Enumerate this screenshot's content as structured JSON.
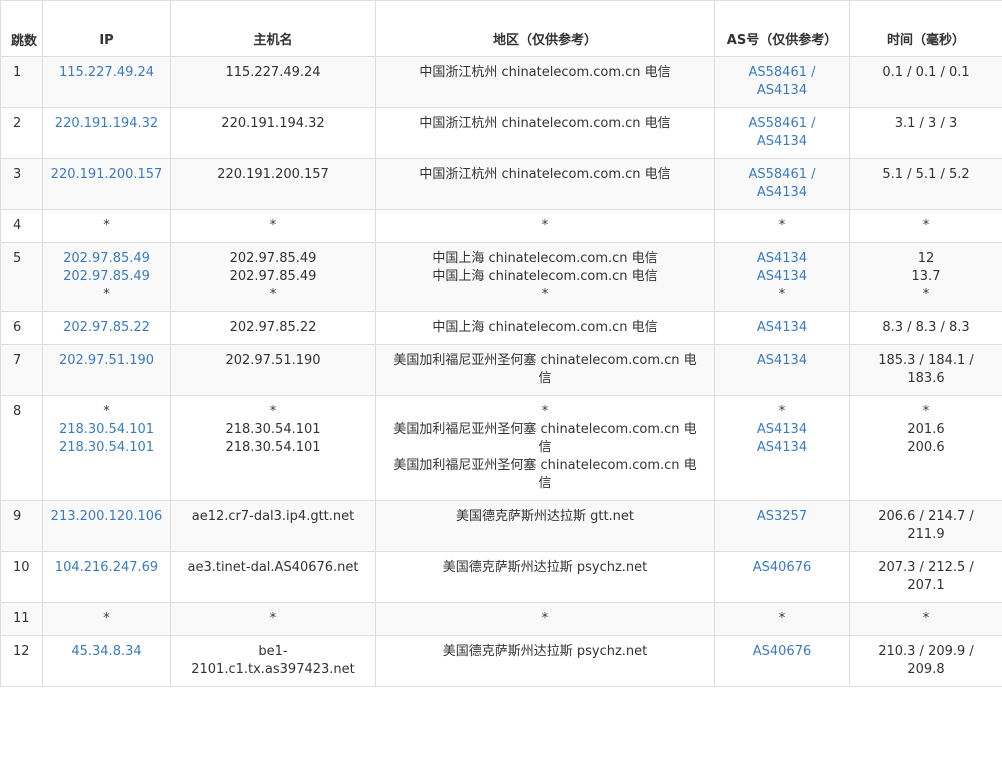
{
  "headers": {
    "hop": "跳数",
    "ip": "IP",
    "hostname": "主机名",
    "region": "地区（仅供参考）",
    "as": "AS号（仅供参考）",
    "time": "时间（毫秒）"
  },
  "colors": {
    "link": "#3a7bbf",
    "stripe": "#f9f9f9",
    "border": "#dddddd",
    "text": "#333333"
  },
  "rows": [
    {
      "hop": "1",
      "ip": [
        "115.227.49.24"
      ],
      "host": [
        "115.227.49.24"
      ],
      "region": [
        "中国浙江杭州 chinatelecom.com.cn 电信"
      ],
      "as": [
        "AS58461 /",
        "AS4134"
      ],
      "time": [
        "0.1 / 0.1 / 0.1"
      ]
    },
    {
      "hop": "2",
      "ip": [
        "220.191.194.32"
      ],
      "host": [
        "220.191.194.32"
      ],
      "region": [
        "中国浙江杭州 chinatelecom.com.cn 电信"
      ],
      "as": [
        "AS58461 /",
        "AS4134"
      ],
      "time": [
        "3.1 / 3 / 3"
      ]
    },
    {
      "hop": "3",
      "ip": [
        "220.191.200.157"
      ],
      "host": [
        "220.191.200.157"
      ],
      "region": [
        "中国浙江杭州 chinatelecom.com.cn 电信"
      ],
      "as": [
        "AS58461 /",
        "AS4134"
      ],
      "time": [
        "5.1 / 5.1 / 5.2"
      ]
    },
    {
      "hop": "4",
      "ip": [
        "*"
      ],
      "host": [
        "*"
      ],
      "region": [
        "*"
      ],
      "as": [
        "*"
      ],
      "time": [
        "*"
      ]
    },
    {
      "hop": "5",
      "ip": [
        "202.97.85.49",
        "202.97.85.49",
        "*"
      ],
      "host": [
        "202.97.85.49",
        "202.97.85.49",
        "*"
      ],
      "region": [
        "中国上海 chinatelecom.com.cn 电信",
        "中国上海 chinatelecom.com.cn 电信",
        "*"
      ],
      "as": [
        "AS4134",
        "AS4134",
        "*"
      ],
      "time": [
        "12",
        "13.7",
        "*"
      ]
    },
    {
      "hop": "6",
      "ip": [
        "202.97.85.22"
      ],
      "host": [
        "202.97.85.22"
      ],
      "region": [
        "中国上海 chinatelecom.com.cn 电信"
      ],
      "as": [
        "AS4134"
      ],
      "time": [
        "8.3 / 8.3 / 8.3"
      ]
    },
    {
      "hop": "7",
      "ip": [
        "202.97.51.190"
      ],
      "host": [
        "202.97.51.190"
      ],
      "region": [
        "美国加利福尼亚州圣何塞 chinatelecom.com.cn 电",
        "信"
      ],
      "as": [
        "AS4134"
      ],
      "time": [
        "185.3 / 184.1 /",
        "183.6"
      ]
    },
    {
      "hop": "8",
      "ip": [
        "*",
        "218.30.54.101",
        "218.30.54.101"
      ],
      "host": [
        "*",
        "218.30.54.101",
        "218.30.54.101"
      ],
      "region": [
        "*",
        "美国加利福尼亚州圣何塞 chinatelecom.com.cn 电",
        "信",
        "美国加利福尼亚州圣何塞 chinatelecom.com.cn 电",
        "信"
      ],
      "as": [
        "*",
        "AS4134",
        "AS4134"
      ],
      "time": [
        "*",
        "201.6",
        "200.6"
      ]
    },
    {
      "hop": "9",
      "ip": [
        "213.200.120.106"
      ],
      "host": [
        "ae12.cr7-dal3.ip4.gtt.net"
      ],
      "region": [
        "美国德克萨斯州达拉斯 gtt.net"
      ],
      "as": [
        "AS3257"
      ],
      "time": [
        "206.6 / 214.7 /",
        "211.9"
      ]
    },
    {
      "hop": "10",
      "ip": [
        "104.216.247.69"
      ],
      "host": [
        "ae3.tinet-dal.AS40676.net"
      ],
      "region": [
        "美国德克萨斯州达拉斯 psychz.net"
      ],
      "as": [
        "AS40676"
      ],
      "time": [
        "207.3 / 212.5 /",
        "207.1"
      ]
    },
    {
      "hop": "11",
      "ip": [
        "*"
      ],
      "host": [
        "*"
      ],
      "region": [
        "*"
      ],
      "as": [
        "*"
      ],
      "time": [
        "*"
      ]
    },
    {
      "hop": "12",
      "ip": [
        "45.34.8.34"
      ],
      "host": [
        "be1-",
        "2101.c1.tx.as397423.net"
      ],
      "region": [
        "美国德克萨斯州达拉斯 psychz.net"
      ],
      "as": [
        "AS40676"
      ],
      "time": [
        "210.3 / 209.9 /",
        "209.8"
      ]
    }
  ]
}
